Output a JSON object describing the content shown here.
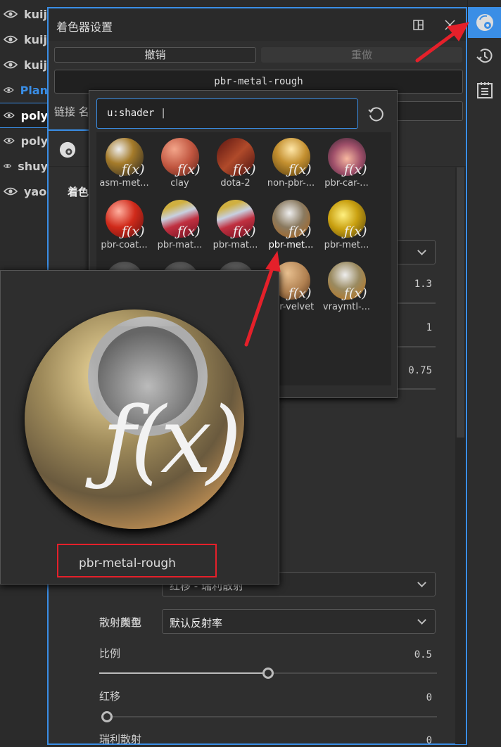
{
  "layers": [
    {
      "name": "kuij",
      "active": false
    },
    {
      "name": "kuij",
      "active": false
    },
    {
      "name": "kuij",
      "active": false
    },
    {
      "name": "Plan",
      "active": false,
      "highlight": true
    },
    {
      "name": "poly",
      "active": true
    },
    {
      "name": "poly",
      "active": false
    },
    {
      "name": "shuy",
      "active": false
    },
    {
      "name": "yao",
      "active": false
    }
  ],
  "right_sidebar": {
    "items": [
      {
        "icon": "shader-settings-icon",
        "active": true
      },
      {
        "icon": "history-icon"
      },
      {
        "icon": "notes-icon"
      }
    ]
  },
  "panel": {
    "title": "着色器设置",
    "undo_label": "撤销",
    "redo_label": "重做",
    "shader_name": "pbr-metal-rough",
    "link_label": "链接 名",
    "tab_label": "着色",
    "values": [
      "1.3",
      "1",
      "0.75"
    ],
    "scatter_type_label": "散射类型",
    "scatter_type_value": "红移 - 瑞利散射",
    "scatter_color_label": "散射颜色",
    "scatter_color_value": "默认反射率",
    "scale_label": "比例",
    "scale_value": "0.5",
    "scale_fraction": 0.5,
    "redshift_label": "红移",
    "redshift_value": "0",
    "redshift_fraction": 0,
    "rayleigh_label": "瑞利散射",
    "rayleigh_value": "0"
  },
  "dropdown": {
    "search_value": "u:shader",
    "items": [
      "asm-met...",
      "clay",
      "dota-2",
      "non-pbr-...",
      "pbr-car-...",
      "pbr-coat...",
      "pbr-mat...",
      "pbr-mat...",
      "pbr-met...",
      "pbr-met...",
      "",
      "",
      "",
      "pbr-velvet",
      "vraymtl-..."
    ],
    "selected_index": 8
  },
  "preview": {
    "name": "pbr-metal-rough"
  },
  "colors": {
    "accent": "#3a8ee6",
    "annotation": "#e5202a"
  }
}
